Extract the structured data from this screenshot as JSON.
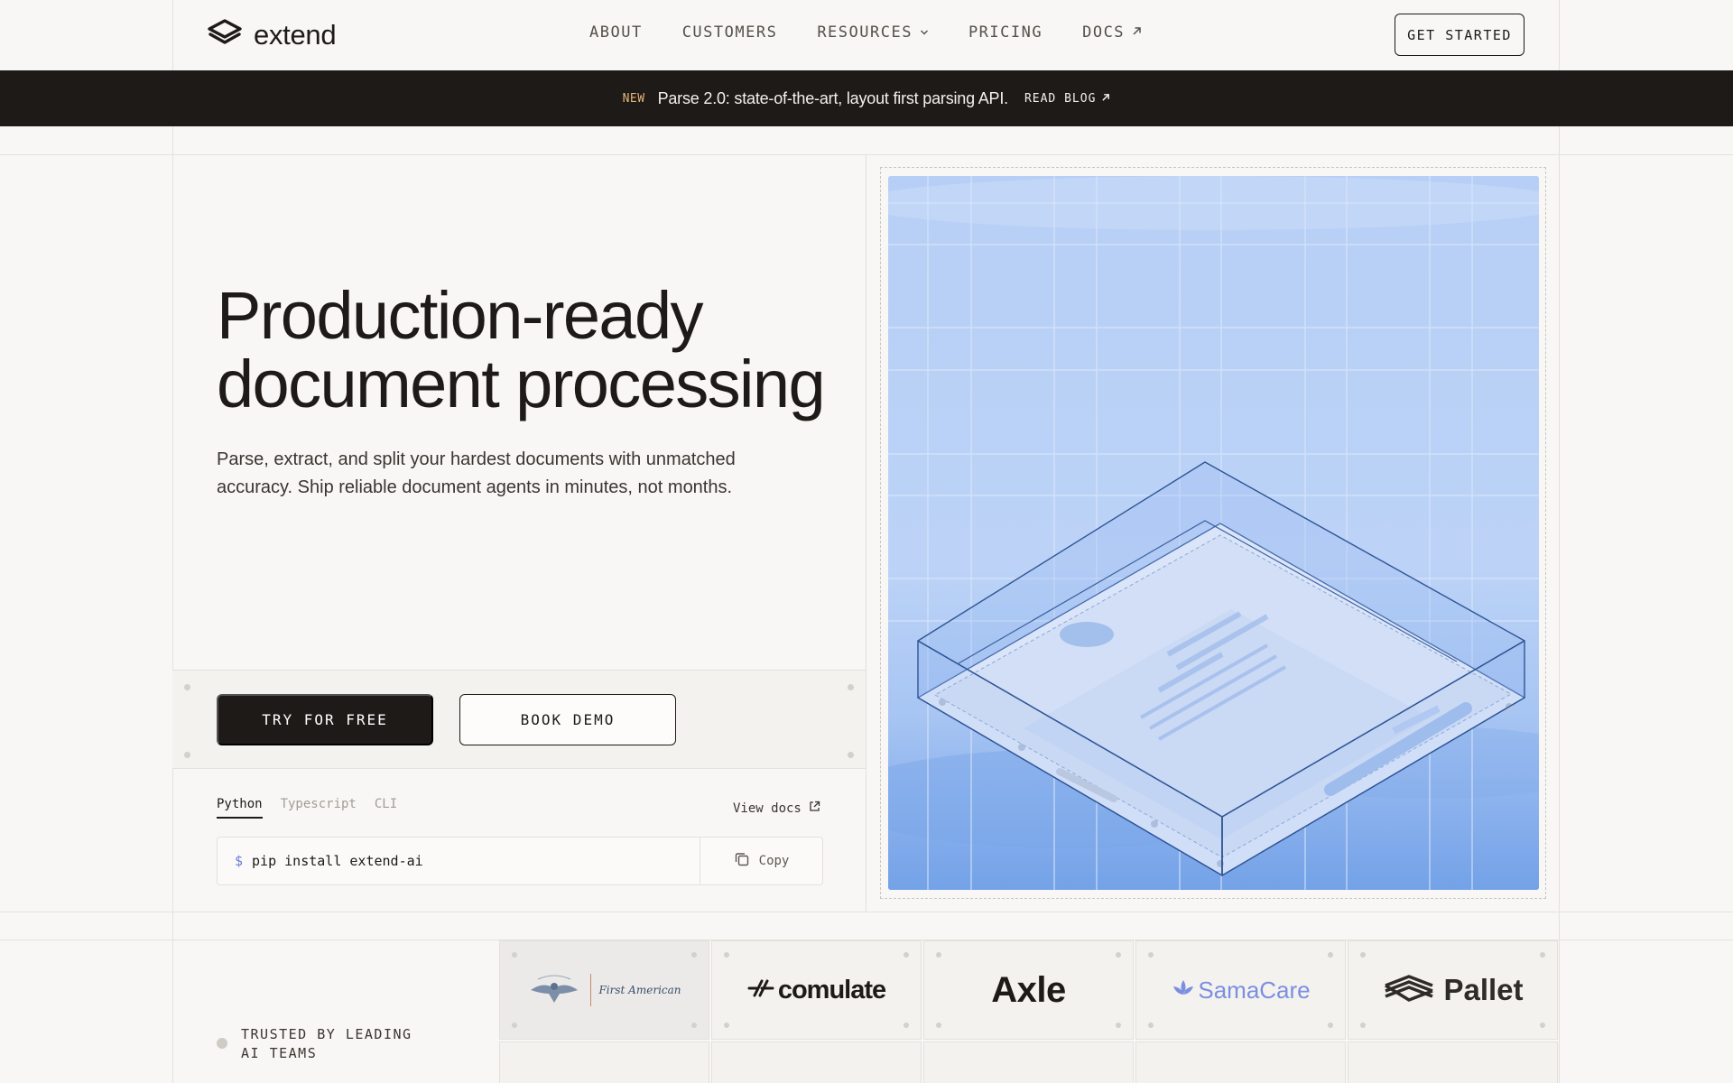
{
  "header": {
    "brand": "extend",
    "nav": [
      {
        "label": "ABOUT"
      },
      {
        "label": "CUSTOMERS"
      },
      {
        "label": "RESOURCES"
      },
      {
        "label": "PRICING"
      },
      {
        "label": "DOCS"
      }
    ],
    "cta": "GET STARTED"
  },
  "banner": {
    "tag": "NEW",
    "message": "Parse 2.0: state-of-the-art, layout first parsing API.",
    "link": "READ BLOG"
  },
  "hero": {
    "title_line1": "Production-ready",
    "title_line2": "document processing",
    "subtitle_line1": "Parse, extract, and split your hardest documents with unmatched",
    "subtitle_line2": "accuracy. Ship reliable document agents in minutes, not months.",
    "primary_cta": "TRY FOR FREE",
    "secondary_cta": "BOOK DEMO"
  },
  "install": {
    "tabs": [
      {
        "label": "Python",
        "active": true
      },
      {
        "label": "Typescript",
        "active": false
      },
      {
        "label": "CLI",
        "active": false
      }
    ],
    "view_docs": "View docs",
    "prompt": "$",
    "command": "pip install extend-ai",
    "copy_label": "Copy"
  },
  "trusted": {
    "line1": "TRUSTED BY LEADING",
    "line2": "AI TEAMS",
    "logos": [
      {
        "name": "First American"
      },
      {
        "name": "comulate"
      },
      {
        "name": "Axle"
      },
      {
        "name": "SamaCare"
      },
      {
        "name": "Pallet"
      }
    ]
  },
  "colors": {
    "ink": "#1d1a17",
    "banner_tag": "#e8b27a",
    "illustration_bg": "#b9d0f6",
    "illustration_line": "#2f5596"
  }
}
